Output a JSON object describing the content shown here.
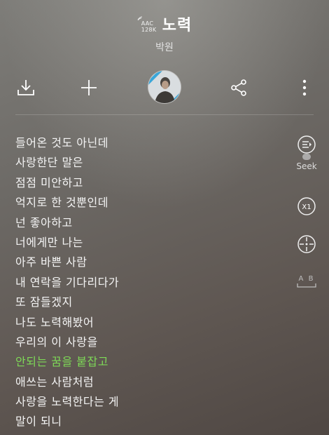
{
  "header": {
    "quality_line1": "AAC",
    "quality_line2": "128K",
    "title": "노력",
    "artist": "박원"
  },
  "toolbar": {
    "download_icon": "download-icon",
    "add_icon": "plus-icon",
    "share_icon": "share-icon",
    "more_icon": "more-vertical-icon"
  },
  "lyrics": {
    "lines": [
      "들어온 것도 아닌데",
      "사랑한단 말은",
      "점점 미안하고",
      "억지로 한 것뿐인데",
      "넌 좋아하고",
      "너에게만 나는",
      "아주 바쁜 사람",
      "내 연락을 기다리다가",
      "또 잠들겠지",
      "나도 노력해봤어",
      "우리의 이 사랑을",
      "안되는 꿈을 붙잡고",
      "애쓰는 사람처럼",
      "사랑을 노력한다는 게",
      "말이 되니"
    ],
    "active_index": 11,
    "active_color": "#7ed957"
  },
  "side": {
    "seek_label": "Seek",
    "speed_label": "X1",
    "ab_label": "A B"
  }
}
